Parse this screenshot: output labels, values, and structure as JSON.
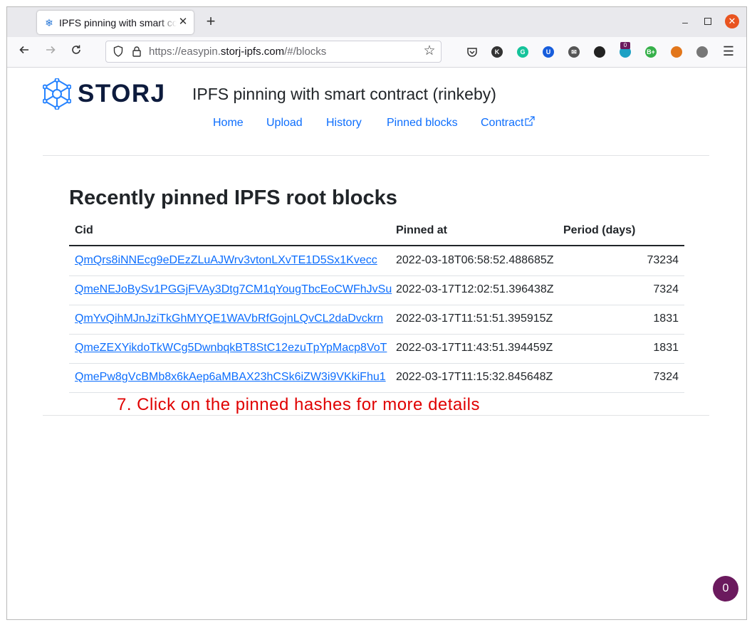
{
  "browser": {
    "tab_title": "IPFS pinning with smart contract",
    "tab_close": "✕",
    "new_tab": "+",
    "url_prefix": "https://easypin.",
    "url_host": "storj-ipfs.com",
    "url_path": "/#/blocks",
    "extension_badge": "0",
    "extensions": [
      {
        "icon": "k-icon",
        "label": "K",
        "color": "#333333"
      },
      {
        "icon": "grammarly-icon",
        "label": "G",
        "color": "#15c39a"
      },
      {
        "icon": "bitwarden-icon",
        "label": "U",
        "color": "#175ddc"
      },
      {
        "icon": "mail-icon",
        "label": "✉",
        "color": "#555555"
      },
      {
        "icon": "gnome-icon",
        "label": "",
        "color": "#222222"
      },
      {
        "icon": "counter-ext-icon",
        "label": "",
        "color": "#1da1c4"
      },
      {
        "icon": "bplus-icon",
        "label": "B+",
        "color": "#36b04a"
      },
      {
        "icon": "metamask-icon",
        "label": "",
        "color": "#e2761b"
      },
      {
        "icon": "cube-icon",
        "label": "",
        "color": "#777777"
      }
    ]
  },
  "site": {
    "logo_text": "STORJ",
    "title": "IPFS pinning with smart contract (rinkeby)",
    "nav": [
      "Home",
      "Upload",
      "History",
      "Pinned blocks",
      "Contract"
    ]
  },
  "main": {
    "heading": "Recently pinned IPFS root blocks",
    "columns": [
      "Cid",
      "Pinned at",
      "Period (days)"
    ],
    "rows": [
      {
        "cid": "QmQrs8iNNEcg9eDEzZLuAJWrv3vtonLXvTE1D5Sx1Kvecc",
        "pinned_at": "2022-03-18T06:58:52.488685Z",
        "period": "73234"
      },
      {
        "cid": "QmeNEJoBySv1PGGjFVAy3Dtg7CM1qYougTbcEoCWFhJvSu",
        "pinned_at": "2022-03-17T12:02:51.396438Z",
        "period": "7324"
      },
      {
        "cid": "QmYvQihMJnJziTkGhMYQE1WAVbRfGojnLQvCL2daDvckrn",
        "pinned_at": "2022-03-17T11:51:51.395915Z",
        "period": "1831"
      },
      {
        "cid": "QmeZEXYikdoTkWCg5DwnbqkBT8StC12ezuTpYpMacp8VoT",
        "pinned_at": "2022-03-17T11:43:51.394459Z",
        "period": "1831"
      },
      {
        "cid": "QmePw8gVcBMb8x6kAep6aMBAX23hCSk6iZW3i9VKkiFhu1",
        "pinned_at": "2022-03-17T11:15:32.845648Z",
        "period": "7324"
      }
    ]
  },
  "annotation": "7. Click on the pinned hashes for more details",
  "chat_badge": "0"
}
